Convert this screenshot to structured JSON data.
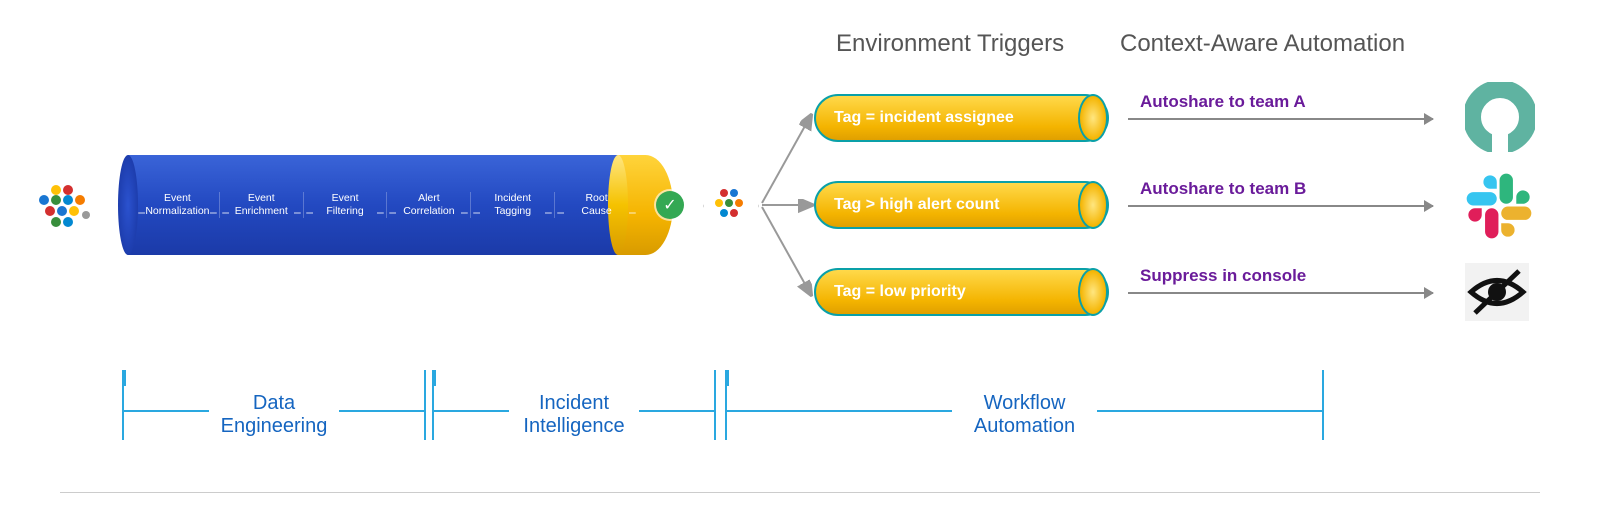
{
  "headers": {
    "triggers": "Environment Triggers",
    "automation": "Context-Aware Automation"
  },
  "pipeline": {
    "stages": [
      "Event Normalization",
      "Event Enrichment",
      "Event Filtering",
      "Alert Correlation",
      "Incident Tagging",
      "Root Cause"
    ],
    "checkmark": "✓"
  },
  "triggers": [
    {
      "label": "Tag = incident assignee",
      "action": "Autoshare to team A"
    },
    {
      "label": "Tag > high alert count",
      "action": "Autoshare to team B"
    },
    {
      "label": "Tag = low priority",
      "action": "Suppress in console"
    }
  ],
  "brackets": [
    {
      "label": "Data Engineering"
    },
    {
      "label": "Incident Intelligence"
    },
    {
      "label": "Workflow Automation"
    }
  ],
  "icons": {
    "source": "bigpanda-cluster",
    "hub": "bigpanda-cluster",
    "destinations": [
      "donut-icon",
      "slack-icon",
      "eye-off-icon"
    ]
  },
  "colors": {
    "blue": "#1e46b8",
    "yellow": "#f4b400",
    "teal": "#4aa99b",
    "purple": "#6a1b9a",
    "bracket": "#2aa8e0"
  }
}
